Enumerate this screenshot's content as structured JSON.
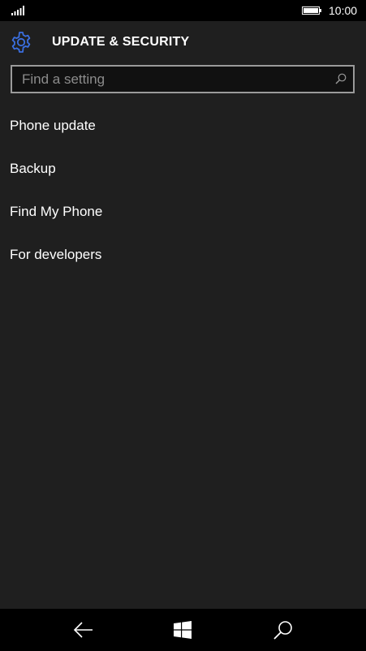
{
  "status_bar": {
    "time": "10:00",
    "signal_icon": "signal-bars-icon",
    "battery_icon": "battery-icon"
  },
  "header": {
    "title": "UPDATE & SECURITY",
    "icon": "gear-icon",
    "accent_color": "#3b6fe0"
  },
  "search": {
    "placeholder": "Find a setting",
    "value": "",
    "icon": "search-icon"
  },
  "menu": {
    "items": [
      {
        "label": "Phone update"
      },
      {
        "label": "Backup"
      },
      {
        "label": "Find My Phone"
      },
      {
        "label": "For developers"
      }
    ]
  },
  "nav_bar": {
    "back_icon": "back-arrow-icon",
    "start_icon": "windows-logo-icon",
    "search_icon": "search-icon"
  },
  "colors": {
    "background": "#1f1f1f",
    "bars": "#000000",
    "text": "#ffffff"
  }
}
